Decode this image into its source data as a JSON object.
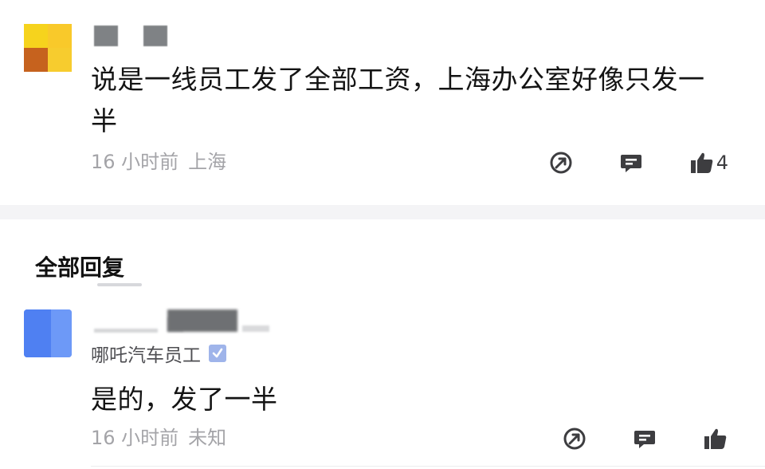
{
  "comment": {
    "text": "说是一线员工发了全部工资，上海办公室好像只发一半",
    "time": "16 小时前",
    "location": "上海",
    "like_count": "4"
  },
  "replies_section": {
    "title": "全部回复"
  },
  "reply": {
    "company": "哪吒汽车员工",
    "text": "是的，发了一半",
    "time": "16 小时前",
    "location": "未知"
  },
  "icons": {
    "share": "share-icon",
    "comment": "comment-icon",
    "like": "thumbs-up-icon",
    "verified": "verified-check-icon"
  },
  "colors": {
    "meta_text": "#a4a4a8",
    "verified_badge": "#9fb4ea"
  }
}
